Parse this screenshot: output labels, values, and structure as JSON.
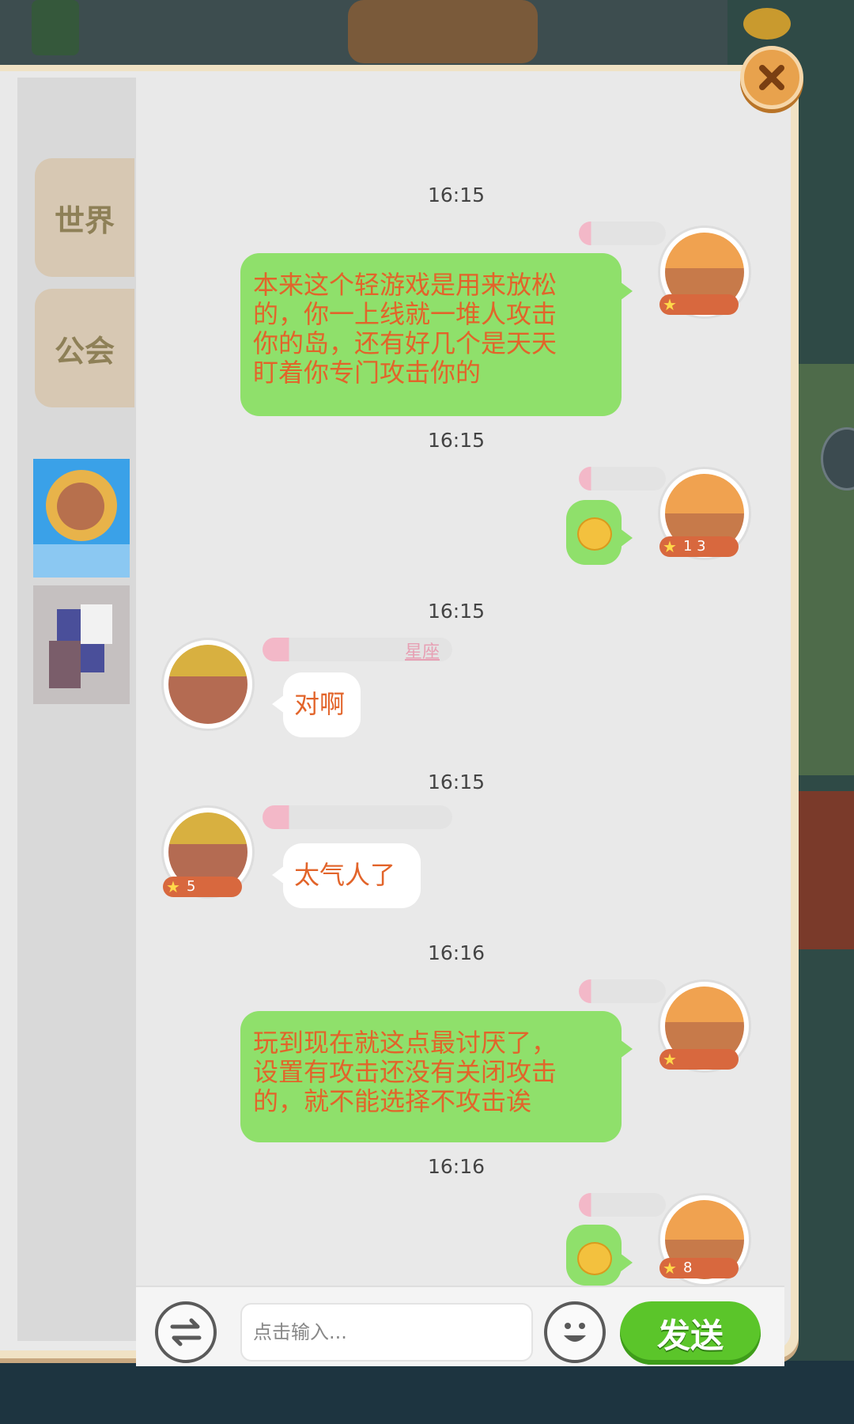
{
  "window": {
    "close_icon": "close-icon"
  },
  "sidebar": {
    "tabs": [
      {
        "label": "世界"
      },
      {
        "label": "公会"
      }
    ]
  },
  "messages": [
    {
      "time": "16:15",
      "side": "right",
      "text_lines": [
        "本来这个轻游戏是用来放松",
        "的，你一上线就一堆人攻击",
        "你的岛，还有好几个是天天",
        "盯着你专门攻击你的"
      ]
    },
    {
      "time": "16:15",
      "side": "right",
      "emoji": "emoji-sticker",
      "badge": "1 3"
    },
    {
      "time": "16:15",
      "side": "left",
      "text": "对啊",
      "name_suffix": "星座"
    },
    {
      "time": "16:15",
      "side": "left",
      "text": "太气人了",
      "badge": "5"
    },
    {
      "time": "16:16",
      "side": "right",
      "text_lines": [
        "玩到现在就这点最讨厌了，",
        "设置有攻击还没有关闭攻击",
        "的，就不能选择不攻击诶"
      ]
    },
    {
      "time": "16:16",
      "side": "right",
      "emoji": "emoji-sticker",
      "badge": "8"
    }
  ],
  "input": {
    "placeholder": "点击输入...",
    "send_label": "发送",
    "switch_icon": "switch-arrows-icon",
    "emoji_icon": "smiley-icon"
  },
  "colors": {
    "bubble_right": "#8fe06b",
    "bubble_left": "#ffffff",
    "message_text": "#e2642a",
    "send_button": "#5bc52a",
    "close_button": "#e8a24d"
  }
}
